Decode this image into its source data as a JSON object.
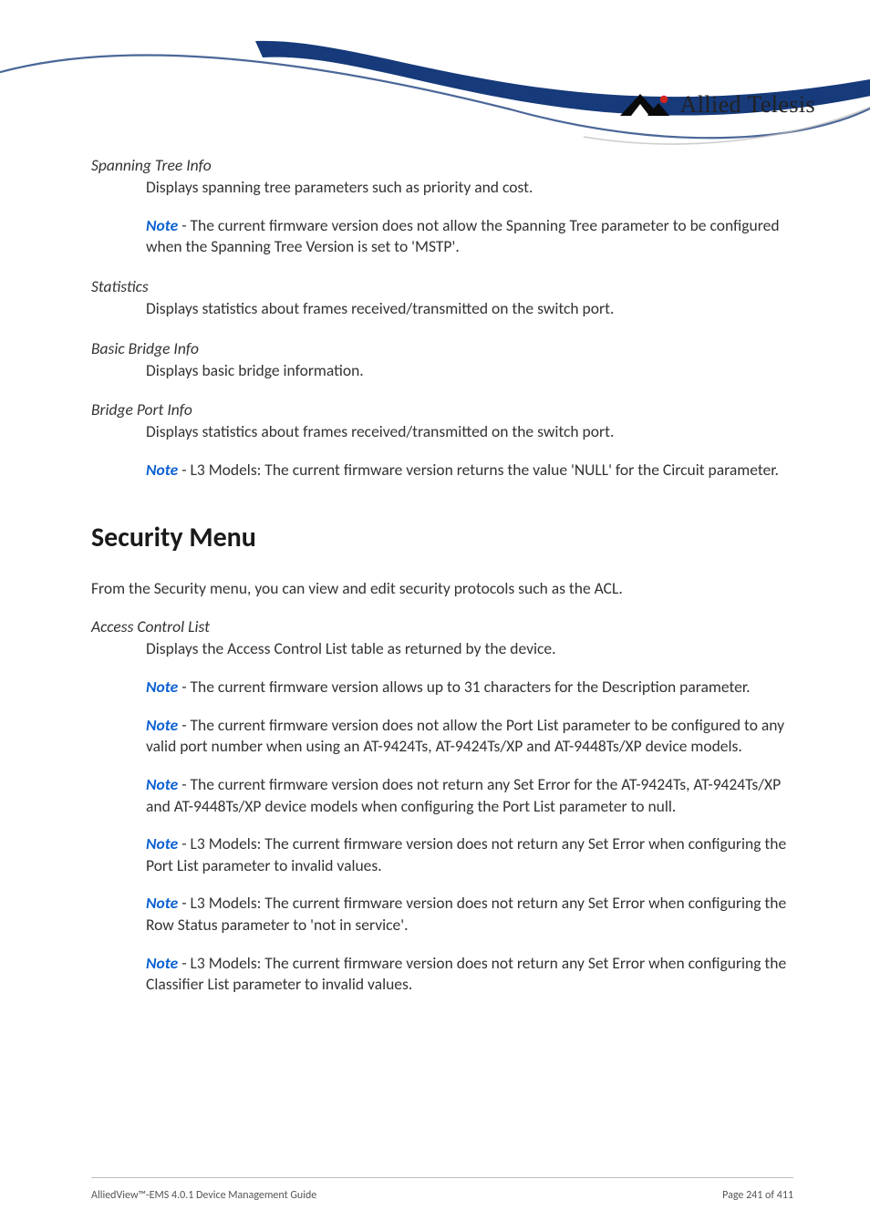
{
  "brand": {
    "logo_text": "Allied Telesis"
  },
  "items": [
    {
      "term": "Spanning Tree Info",
      "desc": "Displays spanning tree parameters such as priority and cost.",
      "notes": [
        "The current firmware version does not allow the Spanning Tree parameter to be configured when the Spanning Tree Version is set to 'MSTP'."
      ]
    },
    {
      "term": "Statistics",
      "desc": "Displays statistics about frames received/transmitted on the switch port.",
      "notes": []
    },
    {
      "term": "Basic Bridge Info",
      "desc": "Displays basic bridge information.",
      "notes": []
    },
    {
      "term": "Bridge Port Info",
      "desc": "Displays statistics about frames received/transmitted on the switch port.",
      "notes": [
        "L3 Models: The current firmware version returns the value 'NULL' for the Circuit parameter."
      ]
    }
  ],
  "section": {
    "heading": "Security Menu",
    "intro": "From the Security menu, you can view and edit security protocols such as the ACL.",
    "items": [
      {
        "term": "Access Control List",
        "desc": "Displays the Access Control List table as returned by the device.",
        "notes": [
          "The current firmware version allows up to 31 characters for the Description parameter.",
          "The current firmware version does not allow the Port List parameter to be configured to any valid port number when using an AT-9424Ts, AT-9424Ts/XP and AT-9448Ts/XP device models.",
          "The current firmware version does not return any Set Error for the AT-9424Ts, AT-9424Ts/XP and AT-9448Ts/XP device models when configuring the Port List parameter to null.",
          "L3 Models: The current firmware version does not return any Set Error when configuring the Port List parameter to invalid values.",
          "L3 Models: The current firmware version does not return any Set Error when configuring the Row Status parameter to 'not in service'.",
          "L3 Models: The current firmware version does not return any Set Error when configuring the Classifier List parameter to invalid values."
        ]
      }
    ]
  },
  "note_label": "Note",
  "footer": {
    "left": "AlliedView™-EMS 4.0.1 Device Management Guide",
    "right": "Page 241 of 411"
  }
}
